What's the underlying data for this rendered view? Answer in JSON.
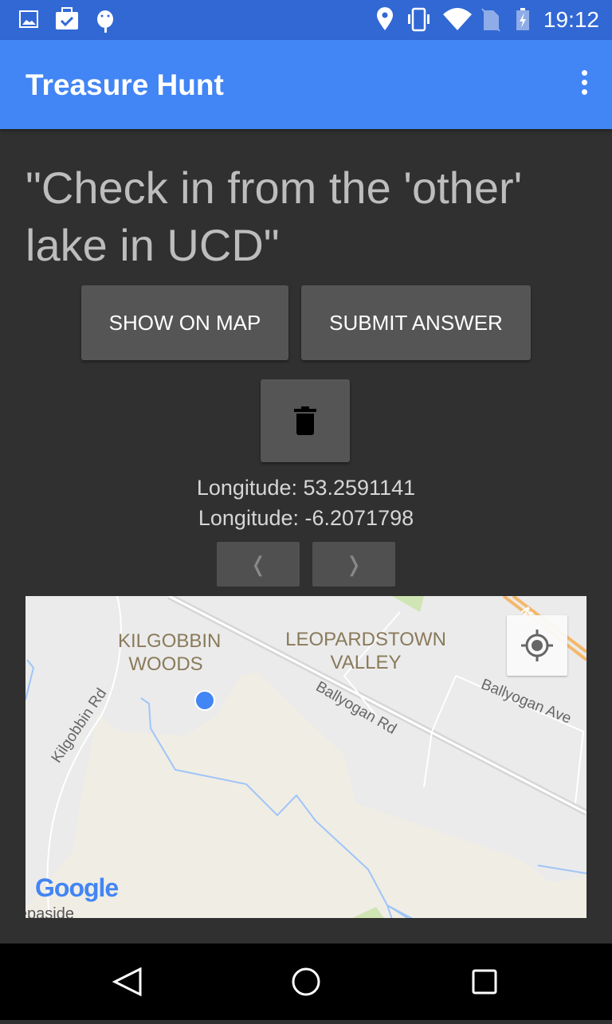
{
  "status_bar": {
    "time": "19:12",
    "icons": [
      "image-icon",
      "clipboard-check-icon",
      "android-icon",
      "location-icon",
      "vibrate-icon",
      "wifi-icon",
      "no-sim-icon",
      "battery-charging-icon"
    ]
  },
  "app_bar": {
    "title": "Treasure Hunt",
    "menu_icon": "more-vert-icon"
  },
  "question": "\"Check in from the 'other' lake in UCD\"",
  "buttons": {
    "show_on_map": "SHOW ON MAP",
    "submit_answer": "SUBMIT ANSWER",
    "delete_icon": "trash-icon"
  },
  "coordinates": {
    "line1": "Longitude: 53.2591141",
    "line2": "Longitude: -6.2071798"
  },
  "pager": {
    "prev": "❬",
    "next": "❭"
  },
  "map": {
    "labels": {
      "kilgobbin_1": "KILGOBBIN",
      "kilgobbin_2": "WOODS",
      "leopardstown_1": "LEOPARDSTOWN",
      "leopardstown_2": "VALLEY",
      "ballyogan_rd": "Ballyogan Rd",
      "ballyogan_ave": "Ballyogan Ave",
      "kilgobbin_rd": "Kilgobbin Rd",
      "m50": "M50",
      "stepaside": "Stepaside"
    },
    "logo": "Google",
    "my_location_icon": "crosshair-icon",
    "colors": {
      "marker": "#4285f4",
      "water": "#9fc5f8",
      "park": "#f0ede5",
      "background": "#ebebeb"
    }
  },
  "nav": {
    "back": "back-icon",
    "home": "home-icon",
    "recents": "recents-icon"
  }
}
